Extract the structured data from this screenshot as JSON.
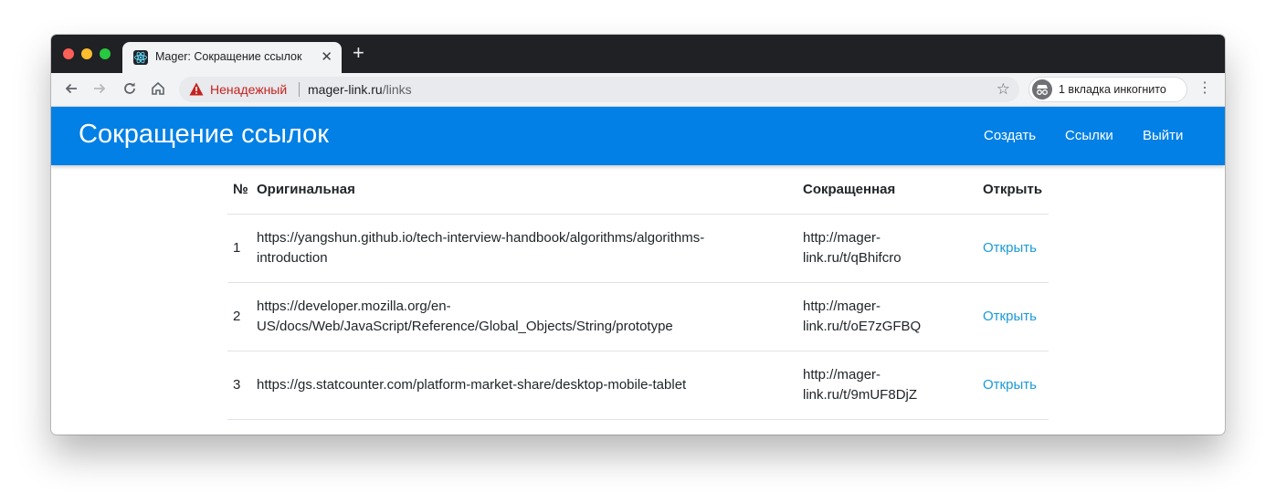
{
  "browser": {
    "tab_title": "Mager: Сокращение ссылок",
    "tab_close": "✕",
    "new_tab": "+",
    "security_label": "Ненадежный",
    "url_host": "mager-link.ru",
    "url_path": "/links",
    "incognito_label": "1 вкладка инкогнито"
  },
  "app": {
    "title": "Сокращение ссылок",
    "nav": {
      "create": "Создать",
      "links": "Ссылки",
      "logout": "Выйти"
    }
  },
  "table": {
    "headers": {
      "num": "№",
      "original": "Оригинальная",
      "short": "Сокращенная",
      "open": "Открыть"
    },
    "rows": [
      {
        "num": "1",
        "original_line1": "https://yangshun.github.io/tech-interview-handbook/algorithms/algorithms-",
        "original_line2": "introduction",
        "short_line1": "http://mager-",
        "short_line2": "link.ru/t/qBhifcro",
        "open": "Открыть"
      },
      {
        "num": "2",
        "original_line1": "https://developer.mozilla.org/en-",
        "original_line2": "US/docs/Web/JavaScript/Reference/Global_Objects/String/prototype",
        "short_line1": "http://mager-",
        "short_line2": "link.ru/t/oE7zGFBQ",
        "open": "Открыть"
      },
      {
        "num": "3",
        "original_line1": "https://gs.statcounter.com/platform-market-share/desktop-mobile-tablet",
        "original_line2": "",
        "short_line1": "http://mager-",
        "short_line2": "link.ru/t/9mUF8DjZ",
        "open": "Открыть"
      }
    ]
  },
  "colors": {
    "header_bg": "#0380e5",
    "link": "#1a9ad6",
    "warning": "#c5221f"
  }
}
